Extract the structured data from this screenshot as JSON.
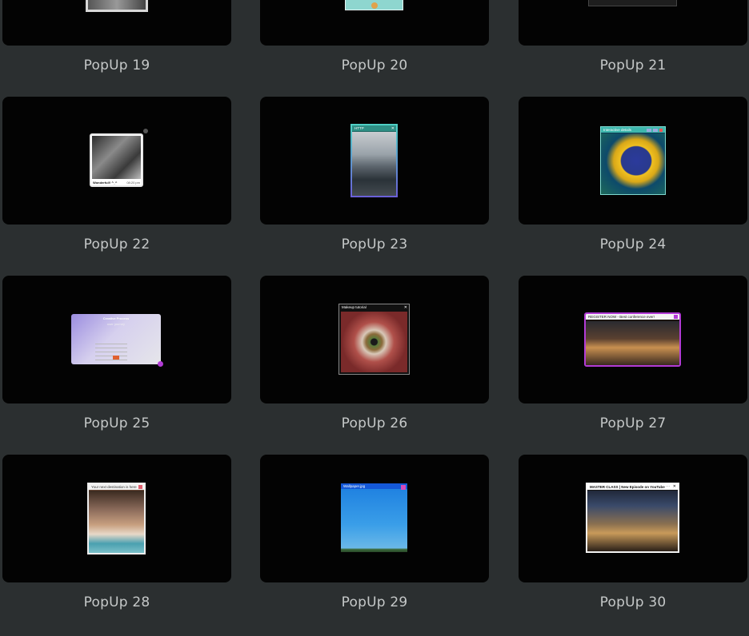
{
  "cards": [
    {
      "label": "PopUp 19"
    },
    {
      "label": "PopUp 20"
    },
    {
      "label": "PopUp 21"
    },
    {
      "label": "PopUp 22",
      "caption": "Wonderful!! ^_^",
      "time": "08:20 pm"
    },
    {
      "label": "PopUp 23",
      "header": "HTTP"
    },
    {
      "label": "PopUp 24",
      "header": "Interactive details"
    },
    {
      "label": "PopUp 25",
      "title": "Creative Process",
      "subtitle": "user journey"
    },
    {
      "label": "PopUp 26",
      "header": "Makeup tutorial"
    },
    {
      "label": "PopUp 27",
      "header": "REGISTER NOW - Best conference ever!"
    },
    {
      "label": "PopUp 28",
      "header": "Your next destination is here"
    },
    {
      "label": "PopUp 29",
      "header": "Wallpaper.jpg"
    },
    {
      "label": "PopUp 30",
      "header": "MASTER CLASS | New Episode on YouTube"
    }
  ],
  "colors": {
    "page_bg": "#2b2f30",
    "card_bg": "#030303",
    "label": "#c5c8c8",
    "accent_purple": "#b23bd6",
    "accent_teal": "#4fd1c5"
  }
}
